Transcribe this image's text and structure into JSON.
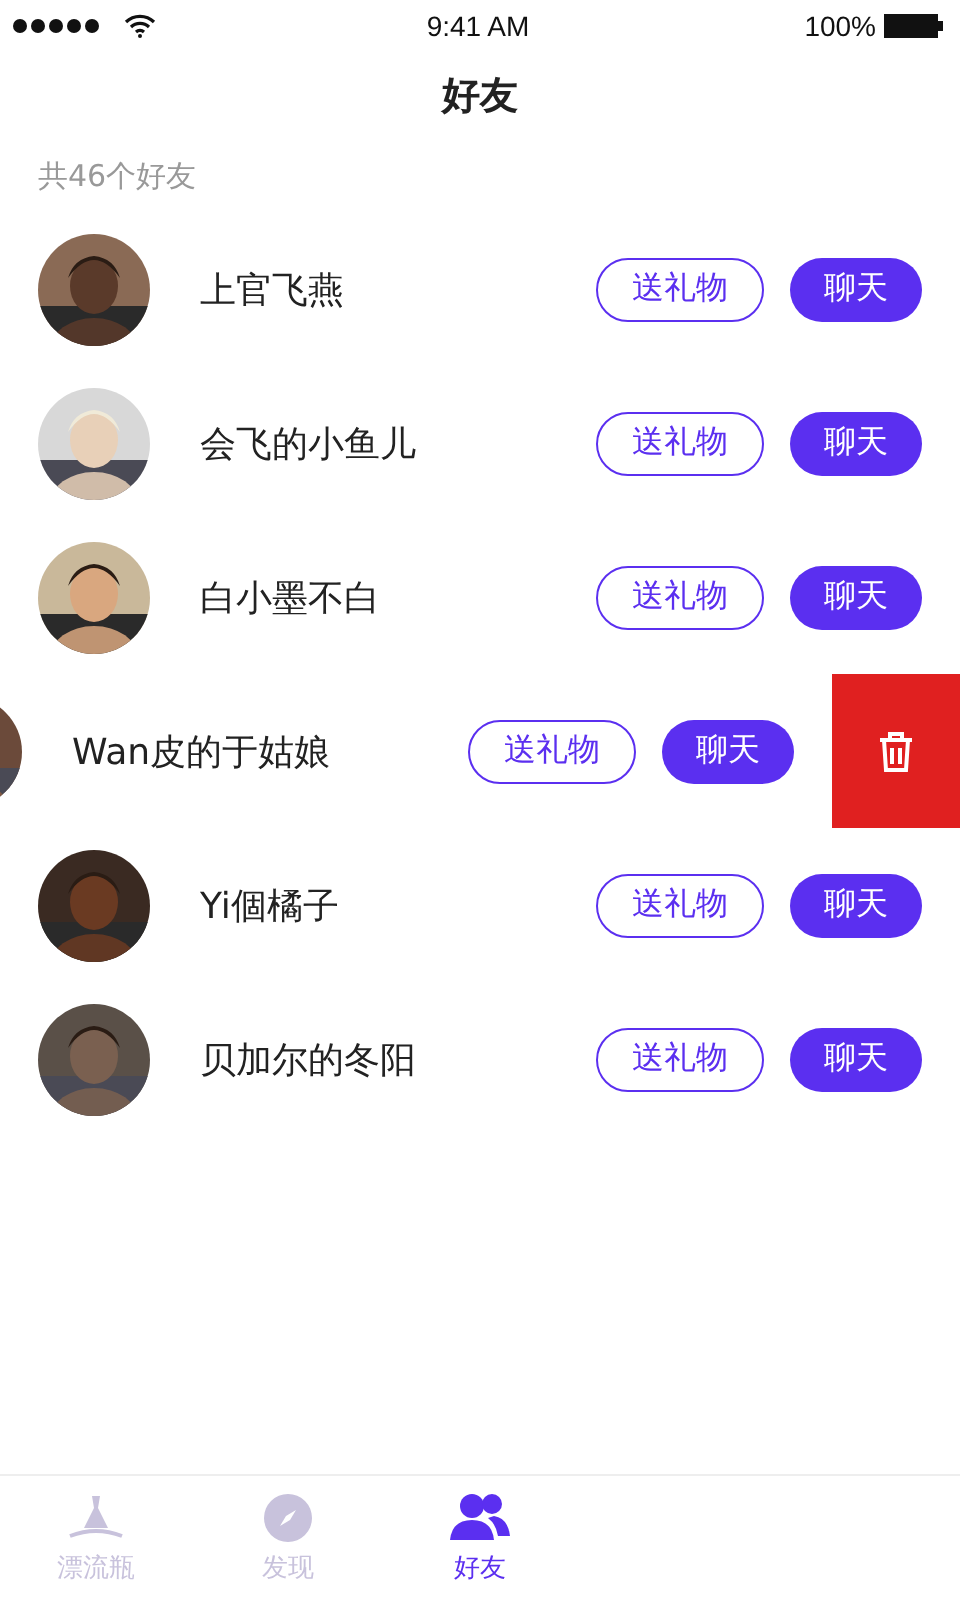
{
  "status_bar": {
    "time": "9:41 AM",
    "battery": "100%"
  },
  "title": "好友",
  "count_label": "共46个好友",
  "friends": [
    {
      "name": "上官飞燕",
      "gift": "送礼物",
      "chat": "聊天",
      "swiped": false
    },
    {
      "name": "会飞的小鱼儿",
      "gift": "送礼物",
      "chat": "聊天",
      "swiped": false
    },
    {
      "name": "白小墨不白",
      "gift": "送礼物",
      "chat": "聊天",
      "swiped": false
    },
    {
      "name": "Wan皮的于姑娘",
      "gift": "送礼物",
      "chat": "聊天",
      "swiped": true
    },
    {
      "name": "Yi個橘子",
      "gift": "送礼物",
      "chat": "聊天",
      "swiped": false
    },
    {
      "name": "贝加尔的冬阳",
      "gift": "送礼物",
      "chat": "聊天",
      "swiped": false
    }
  ],
  "tabs": [
    {
      "label": "漂流瓶",
      "kind": "bottle",
      "selected": false
    },
    {
      "label": "发现",
      "kind": "compass",
      "selected": false
    },
    {
      "label": "好友",
      "kind": "friends",
      "selected": true
    }
  ]
}
